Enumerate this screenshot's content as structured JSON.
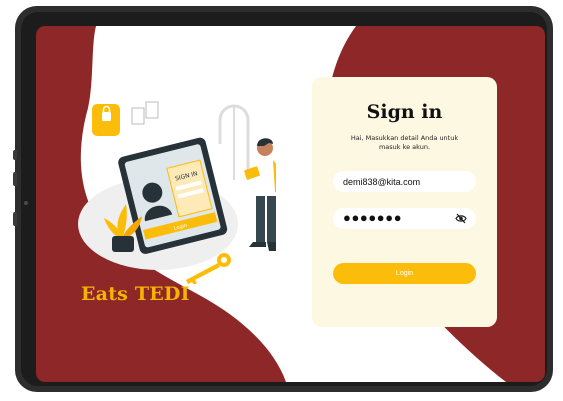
{
  "brand": {
    "name": "Eats TEDI"
  },
  "illustration": {
    "signin_label": "SIGN IN",
    "login_label": "Login"
  },
  "signin": {
    "title": "Sign in",
    "subtitle": "Hai, Masukkan detail Anda untuk masuk ke akun.",
    "email_value": "demi838@kita.com",
    "password_value": "●●●●●●●",
    "password_icon": "eye-off-icon",
    "login_label": "Login"
  },
  "colors": {
    "background": "#8e2727",
    "accent": "#fcbd0a",
    "card": "#fdf8e2",
    "brand_text": "#f5b400"
  }
}
